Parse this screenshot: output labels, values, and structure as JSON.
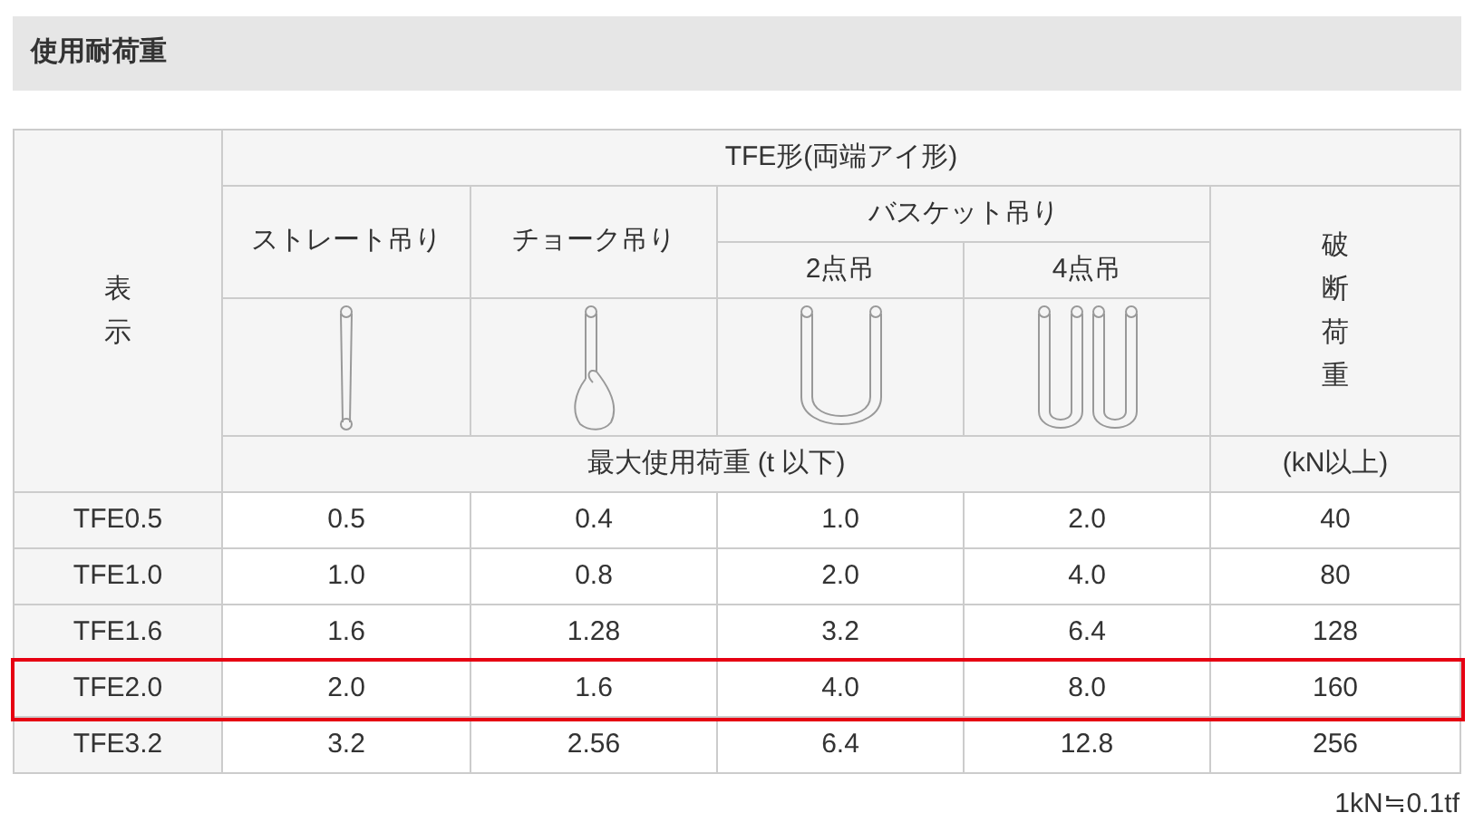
{
  "section_title": "使用耐荷重",
  "table": {
    "header": {
      "label_col": "表示",
      "group": "TFE形(両端アイ形)",
      "straight": "ストレート吊り",
      "choke": "チョーク吊り",
      "basket": "バスケット吊り",
      "basket_2": "2点吊",
      "basket_4": "4点吊",
      "breaking": "破断荷重",
      "unit_load": "最大使用荷重 (t 以下)",
      "unit_break": "(kN以上)"
    },
    "rows": [
      {
        "cells": [
          "TFE0.5",
          "0.5",
          "0.4",
          "1.0",
          "2.0",
          "40"
        ],
        "selected": false
      },
      {
        "cells": [
          "TFE1.0",
          "1.0",
          "0.8",
          "2.0",
          "4.0",
          "80"
        ],
        "selected": false
      },
      {
        "cells": [
          "TFE1.6",
          "1.6",
          "1.28",
          "3.2",
          "6.4",
          "128"
        ],
        "selected": false
      },
      {
        "cells": [
          "TFE2.0",
          "2.0",
          "1.6",
          "4.0",
          "8.0",
          "160"
        ],
        "selected": true
      },
      {
        "cells": [
          "TFE3.2",
          "3.2",
          "2.56",
          "6.4",
          "12.8",
          "256"
        ],
        "selected": false
      }
    ]
  },
  "footnote": "1kN≒0.1tf"
}
